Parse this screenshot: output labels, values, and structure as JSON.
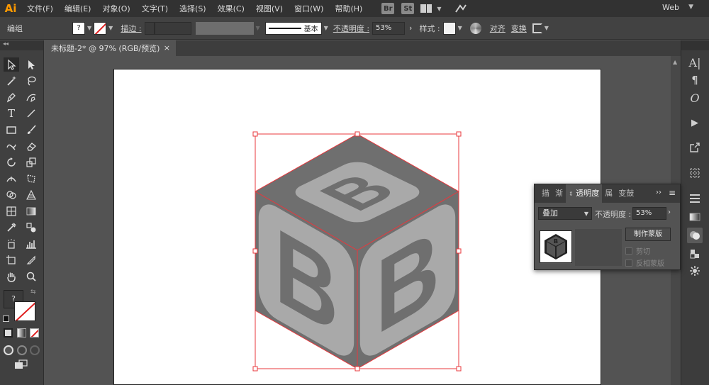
{
  "app": {
    "logo": "Ai"
  },
  "menu": [
    "文件(F)",
    "编辑(E)",
    "对象(O)",
    "文字(T)",
    "选择(S)",
    "效果(C)",
    "视图(V)",
    "窗口(W)",
    "帮助(H)"
  ],
  "menubar_icons": {
    "bridge": "Br",
    "stock": "St"
  },
  "workspace": "Web",
  "controlbar": {
    "selection": "编组",
    "fill_icon": "?",
    "stroke_label": "描边 :",
    "stroke_style": "基本",
    "opacity_label": "不透明度 :",
    "opacity_value": "53%",
    "style_label": "样式 :",
    "align_label": "对齐",
    "transform_label": "变换"
  },
  "document_tab": {
    "title": "未标题-2* @ 97% (RGB/预览)",
    "close": "×"
  },
  "toolbar": {
    "collapse": "◂◂",
    "fill_stroke_unknown": "?"
  },
  "transparency_panel": {
    "tabs": [
      "描",
      "渐",
      "透明度",
      "属",
      "变鼓"
    ],
    "active_tab": "透明度",
    "blend_mode": "叠加",
    "opacity_label": "不透明度 :",
    "opacity_value": "53%",
    "make_mask_label": "制作蒙版",
    "clip_label": "剪切",
    "invert_mask_label": "反相蒙版"
  },
  "artwork": {
    "letter": "B"
  },
  "colors": {
    "accent": "#ff9a00",
    "selection": "#e8383d",
    "cube_dark": "#6f6f6f",
    "cube_light": "#a9a9a9"
  }
}
